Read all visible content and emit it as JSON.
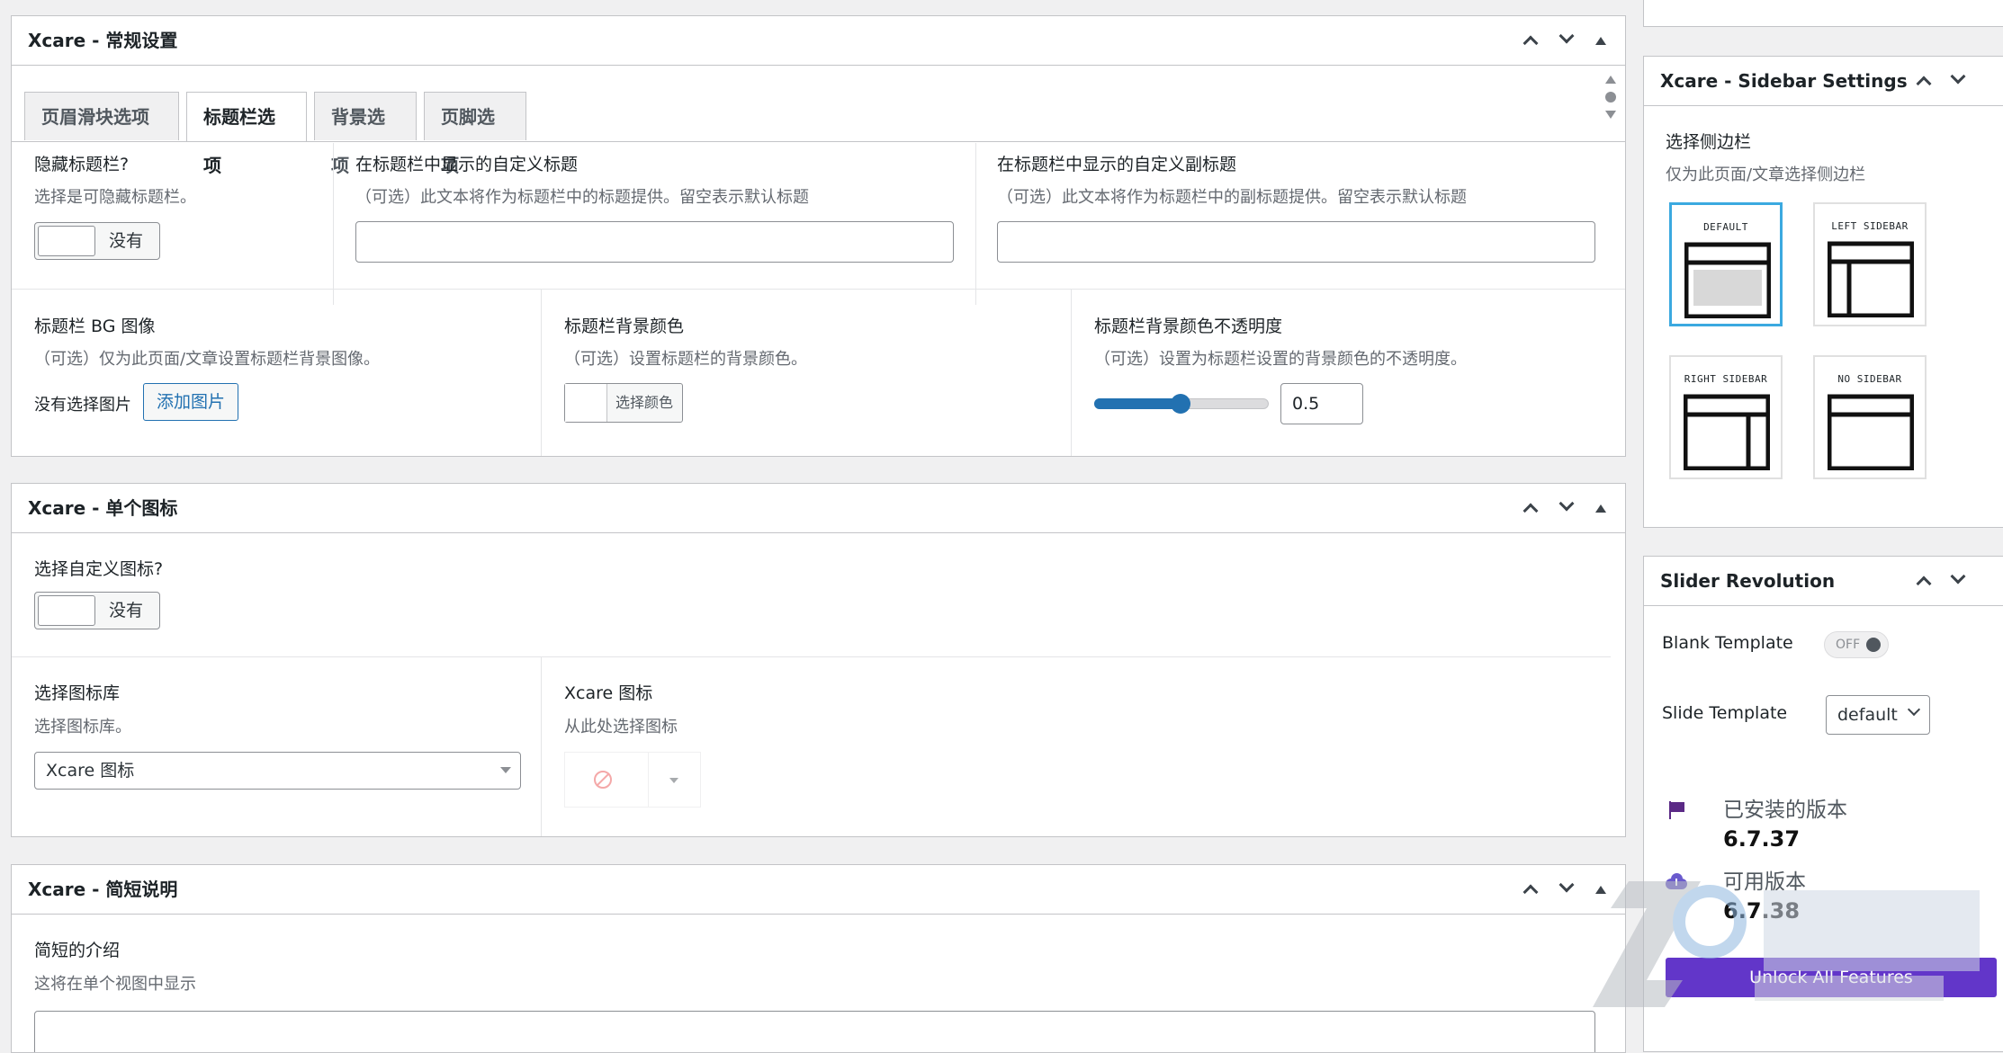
{
  "general": {
    "title": "Xcare - 常规设置",
    "tabs": [
      "页眉滑块选项",
      "标题栏选项",
      "背景选项",
      "页脚选项"
    ],
    "hide_titlebar": {
      "label": "隐藏标题栏?",
      "desc": "选择是可隐藏标题栏。",
      "toggle_label": "没有"
    },
    "custom_title": {
      "label": "在标题栏中显示的自定义标题",
      "desc": "（可选）此文本将作为标题栏中的标题提供。留空表示默认标题",
      "value": ""
    },
    "custom_subtitle": {
      "label": "在标题栏中显示的自定义副标题",
      "desc": "（可选）此文本将作为标题栏中的副标题提供。留空表示默认标题",
      "value": ""
    },
    "bg_image": {
      "label": "标题栏 BG 图像",
      "desc": "（可选）仅为此页面/文章设置标题栏背景图像。",
      "status": "没有选择图片",
      "button": "添加图片"
    },
    "bg_color": {
      "label": "标题栏背景颜色",
      "desc": "（可选）设置标题栏的背景颜色。",
      "button": "选择颜色"
    },
    "bg_opacity": {
      "label": "标题栏背景颜色不透明度",
      "desc": "（可选）设置为标题栏设置的背景颜色的不透明度。",
      "value": "0.5",
      "level": 0.5
    }
  },
  "single_icon": {
    "title": "Xcare - 单个图标",
    "custom_icon": {
      "label": "选择自定义图标?",
      "toggle_label": "没有"
    },
    "library": {
      "label": "选择图标库",
      "desc": "选择图标库。",
      "selected": "Xcare 图标"
    },
    "icon": {
      "label": "Xcare 图标",
      "desc": "从此处选择图标"
    }
  },
  "short_desc": {
    "title": "Xcare - 简短说明",
    "field": {
      "label": "简短的介绍",
      "desc": "这将在单个视图中显示"
    }
  },
  "sidebar": {
    "title": "Xcare - Sidebar Settings",
    "label": "选择侧边栏",
    "desc": "仅为此页面/文章选择侧边栏",
    "options": [
      "DEFAULT",
      "LEFT SIDEBAR",
      "RIGHT SIDEBAR",
      "NO SIDEBAR"
    ],
    "selected": "DEFAULT"
  },
  "slider_revolution": {
    "title": "Slider Revolution",
    "blank_template": {
      "label": "Blank Template",
      "state": "OFF"
    },
    "slide_template": {
      "label": "Slide Template",
      "selected": "default"
    },
    "installed": {
      "label": "已安装的版本",
      "version": "6.7.37"
    },
    "available": {
      "label": "可用版本",
      "version": "6.7.38"
    },
    "unlock": "Unlock All Features"
  },
  "colors": {
    "accent": "#2271b1",
    "selected_layout": "#3ba9e0",
    "unlock": "#6236c9",
    "flag": "#5b2a86"
  }
}
